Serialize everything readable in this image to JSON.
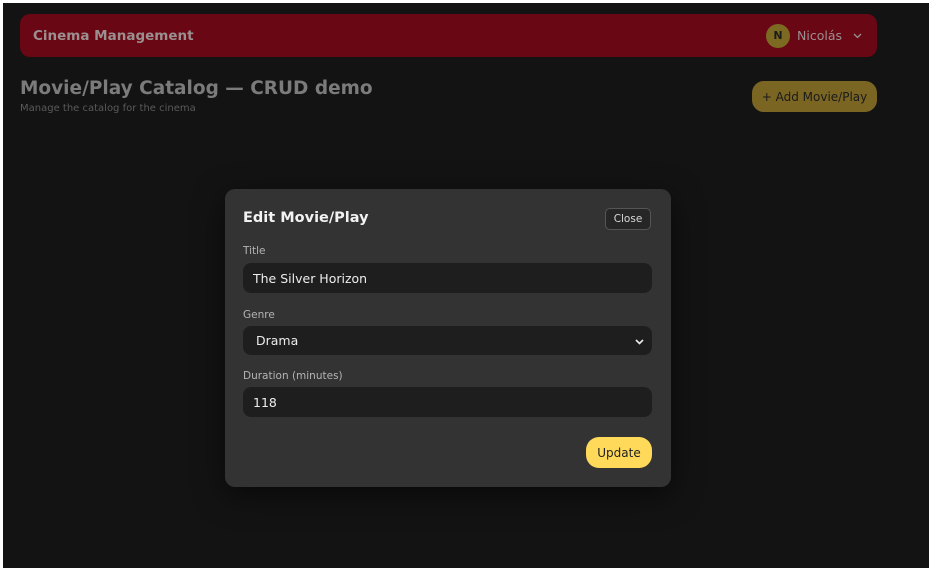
{
  "app": {
    "brand": "Cinema Management",
    "user": {
      "initial": "N",
      "name": "Nicolás"
    }
  },
  "page": {
    "title": "Movie/Play Catalog — CRUD demo",
    "subtitle": "Manage the catalog for the cinema",
    "add_button": "+ Add Movie/Play"
  },
  "modal": {
    "title": "Edit Movie/Play",
    "close_label": "Close",
    "fields": {
      "title": {
        "label": "Title",
        "value": "The Silver Horizon"
      },
      "genre": {
        "label": "Genre",
        "value": "Drama"
      },
      "duration": {
        "label": "Duration (minutes)",
        "value": "118"
      }
    },
    "submit_label": "Update"
  },
  "colors": {
    "topbar": "#6a0714",
    "background": "#131313",
    "modal": "#333333",
    "accent": "#ffd95a"
  },
  "icons": {
    "user_menu": "chevron-down-icon",
    "select": "chevron-down-icon"
  }
}
